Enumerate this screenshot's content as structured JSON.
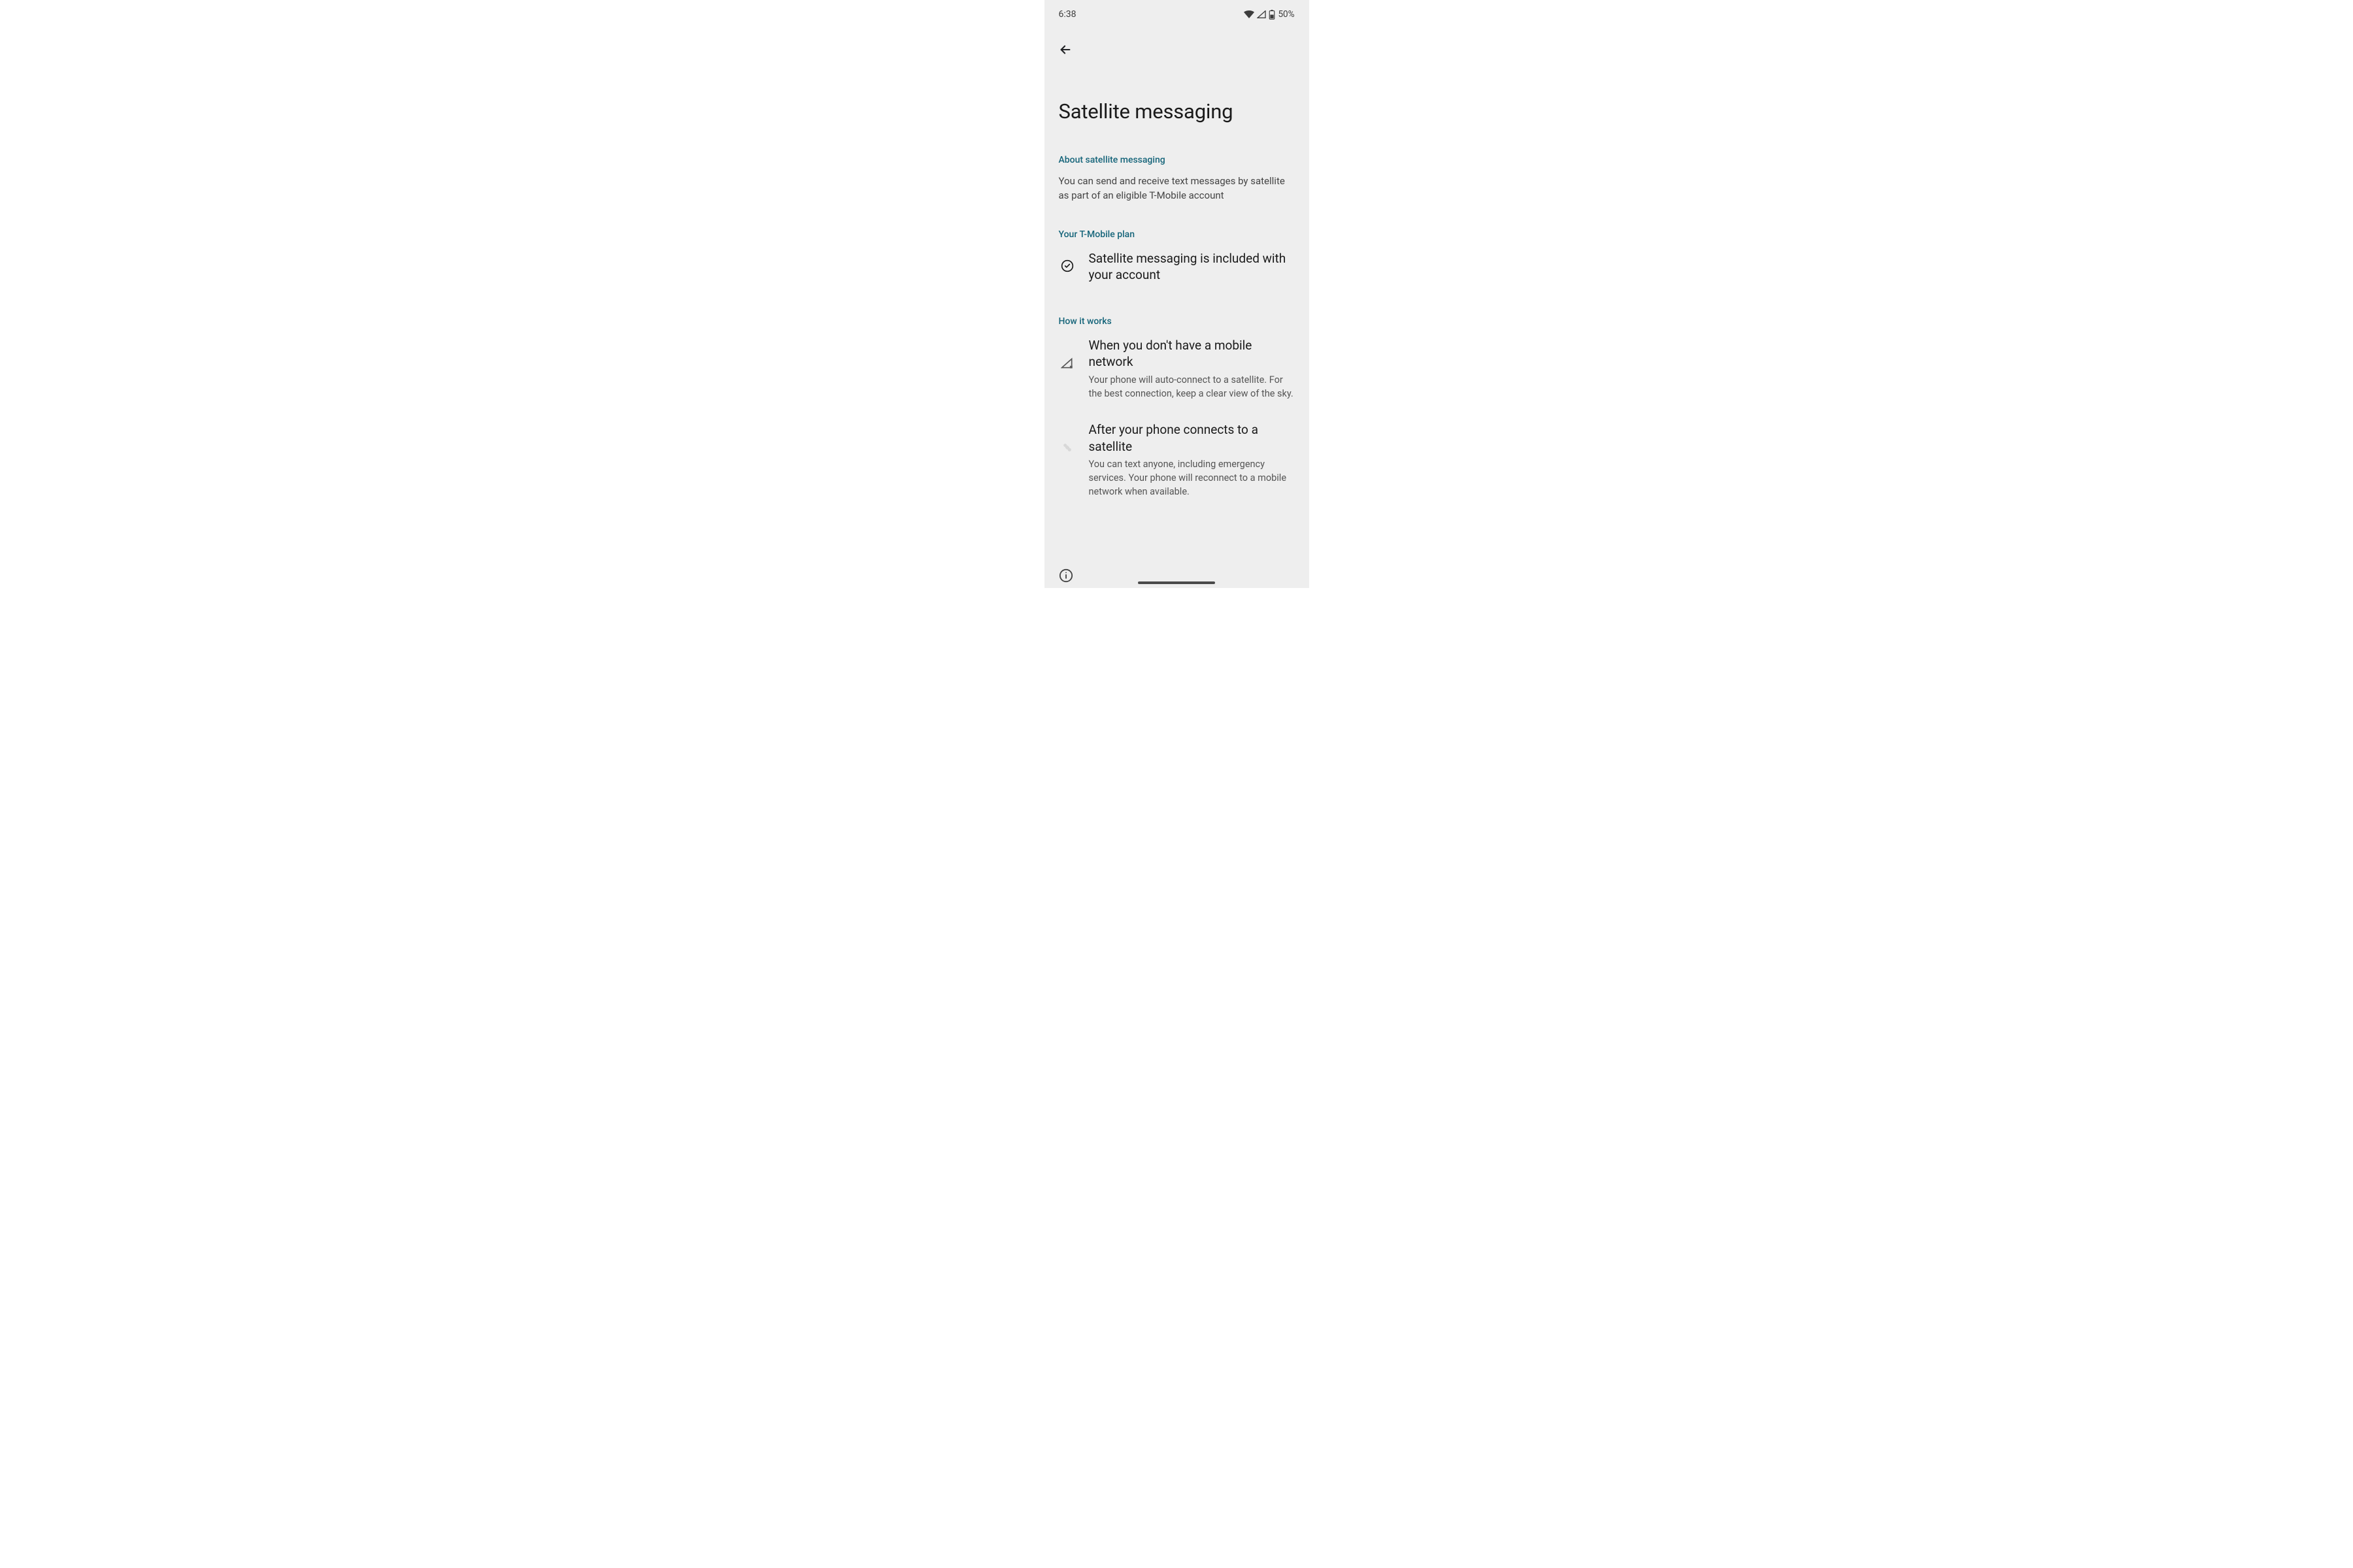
{
  "status_bar": {
    "time": "6:38",
    "battery_percent": "50%"
  },
  "page": {
    "title": "Satellite messaging"
  },
  "sections": {
    "about": {
      "label": "About satellite messaging",
      "body": "You can send and receive text messages by satellite as part of an eligible T-Mobile account"
    },
    "plan": {
      "label": "Your T-Mobile plan",
      "item_title": "Satellite messaging is included with your account"
    },
    "how": {
      "label": "How it works",
      "items": [
        {
          "title": "When you don't have a mobile network",
          "desc": "Your phone will auto-connect to a satellite. For the best connection, keep a clear view of the sky."
        },
        {
          "title": "After your phone connects to a satellite",
          "desc": "You can text anyone, including emergency services. Your phone will reconnect to a mobile network when available."
        }
      ]
    }
  }
}
